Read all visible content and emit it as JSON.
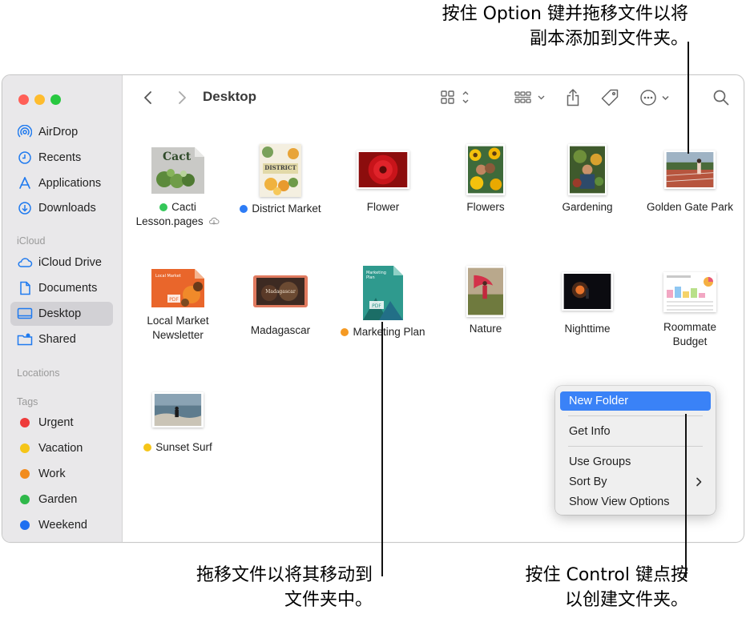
{
  "callouts": {
    "top": [
      "按住 Option 键并拖移文件以将",
      "副本添加到文件夹。"
    ],
    "bottom_left": [
      "拖移文件以将其移动到",
      "文件夹中。"
    ],
    "bottom_right": [
      "按住 Control 键点按",
      "以创建文件夹。"
    ]
  },
  "window": {
    "title": "Desktop"
  },
  "sidebar": {
    "favorites": [
      {
        "label": "AirDrop",
        "icon": "airdrop-icon"
      },
      {
        "label": "Recents",
        "icon": "clock-icon"
      },
      {
        "label": "Applications",
        "icon": "applications-icon"
      },
      {
        "label": "Downloads",
        "icon": "download-icon"
      }
    ],
    "icloud_header": "iCloud",
    "icloud": [
      {
        "label": "iCloud Drive",
        "icon": "cloud-icon"
      },
      {
        "label": "Documents",
        "icon": "document-icon"
      },
      {
        "label": "Desktop",
        "icon": "desktop-icon",
        "selected": true
      },
      {
        "label": "Shared",
        "icon": "shared-folder-icon"
      }
    ],
    "locations_header": "Locations",
    "tags_header": "Tags",
    "tags": [
      {
        "label": "Urgent",
        "color": "#ee3b3b"
      },
      {
        "label": "Vacation",
        "color": "#f5c518"
      },
      {
        "label": "Work",
        "color": "#f28c1e"
      },
      {
        "label": "Garden",
        "color": "#2fb84a"
      },
      {
        "label": "Weekend",
        "color": "#1f6ff0"
      }
    ]
  },
  "files": [
    {
      "name": "Cacti Lesson.pages",
      "line1": "Cacti",
      "line2": "Lesson.pages",
      "tag_color": "#34c759",
      "cloud": true
    },
    {
      "name": "District Market",
      "tag_color": "#2d7cf6"
    },
    {
      "name": "Flower"
    },
    {
      "name": "Flowers"
    },
    {
      "name": "Gardening"
    },
    {
      "name": "Golden Gate Park"
    },
    {
      "name": "Local Market Newsletter",
      "line1": "Local Market",
      "line2": "Newsletter"
    },
    {
      "name": "Madagascar"
    },
    {
      "name": "Marketing Plan",
      "tag_color": "#f59a23"
    },
    {
      "name": "Nature"
    },
    {
      "name": "Nighttime"
    },
    {
      "name": "Roommate Budget",
      "line1": "Roommate",
      "line2": "Budget"
    },
    {
      "name": "Sunset Surf",
      "tag_color": "#f5c518"
    }
  ],
  "context_menu": {
    "new_folder": "New Folder",
    "get_info": "Get Info",
    "use_groups": "Use Groups",
    "sort_by": "Sort By",
    "show_view_options": "Show View Options"
  }
}
